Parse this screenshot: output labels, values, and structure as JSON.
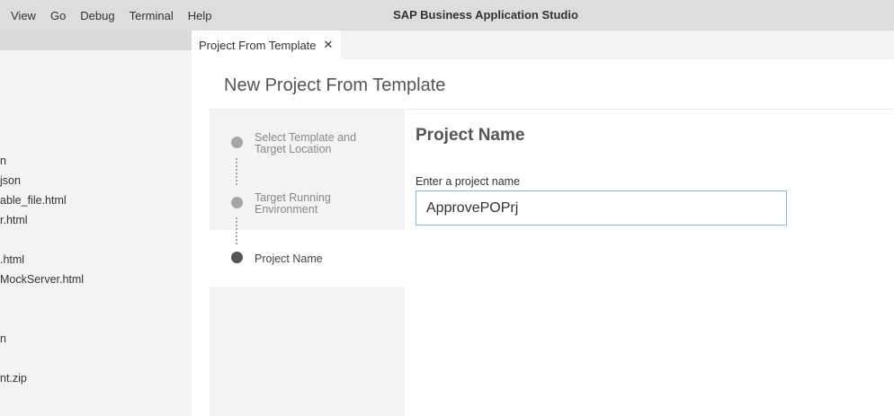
{
  "menu": {
    "items": [
      "View",
      "Go",
      "Debug",
      "Terminal",
      "Help"
    ]
  },
  "app_title": "SAP Business Application Studio",
  "explorer": {
    "items": [
      "n",
      "json",
      "able_file.html",
      "r.html",
      ".html",
      "MockServer.html",
      "n",
      "nt.zip"
    ]
  },
  "tabs": [
    {
      "label": "Project From Template",
      "close": "✕"
    }
  ],
  "wizard": {
    "title": "New Project From Template",
    "steps": [
      {
        "label": "Select Template and Target Location",
        "state": "done"
      },
      {
        "label": "Target Running Environment",
        "state": "done"
      },
      {
        "label": "Project Name",
        "state": "active"
      }
    ],
    "section_title": "Project Name",
    "field_label": "Enter a project name",
    "field_value": "ApprovePOPrj"
  }
}
